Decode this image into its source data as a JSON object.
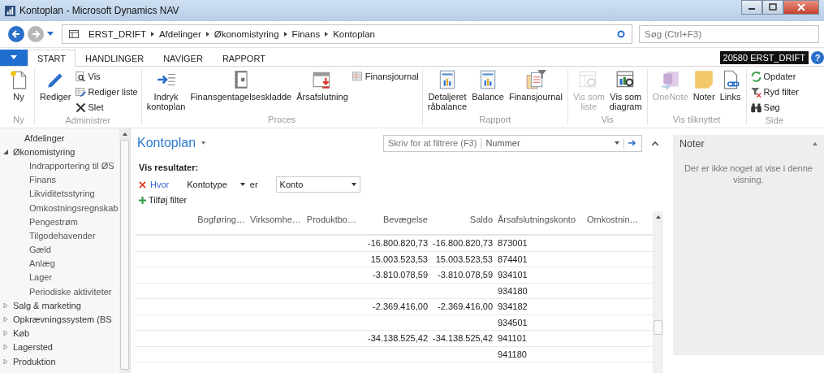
{
  "window": {
    "title": "Kontoplan - Microsoft Dynamics NAV"
  },
  "address_bar": {
    "breadcrumb": [
      "ERST_DRIFT",
      "Afdelinger",
      "Økonomistyring",
      "Finans",
      "Kontoplan"
    ],
    "search": {
      "placeholder": "Søg (Ctrl+F3)"
    }
  },
  "ribbon_tabs": [
    {
      "label": "START",
      "selected": true
    },
    {
      "label": "HANDLINGER",
      "selected": false
    },
    {
      "label": "NAVIGER",
      "selected": false
    },
    {
      "label": "RAPPORT",
      "selected": false
    }
  ],
  "company_badge": "20580 ERST_DRIFT",
  "help": "?",
  "ribbon_groups": [
    {
      "label": "Ny",
      "buttons": [
        {
          "label": "Ny",
          "kind": "large",
          "disabled": false
        }
      ]
    },
    {
      "label": "Administrer",
      "buttons": [
        {
          "label": "Rediger",
          "kind": "large",
          "disabled": false
        },
        {
          "label": "Vis",
          "kind": "small",
          "disabled": false
        },
        {
          "label": "Rediger liste",
          "kind": "small",
          "disabled": false
        },
        {
          "label": "Slet",
          "kind": "small",
          "disabled": false
        }
      ]
    },
    {
      "label": "Proces",
      "buttons": [
        {
          "label": "Indryk\nkontoplan",
          "kind": "large",
          "disabled": false
        },
        {
          "label": "Finansgentagelseskladde",
          "kind": "large",
          "disabled": false
        },
        {
          "label": "Årsafslutning",
          "kind": "large",
          "disabled": false
        },
        {
          "label": "Finansjournal",
          "kind": "small",
          "disabled": false
        }
      ]
    },
    {
      "label": "Rapport",
      "buttons": [
        {
          "label": "Detaljeret\nråbalance",
          "kind": "large",
          "disabled": false
        },
        {
          "label": "Balance",
          "kind": "large",
          "disabled": false
        },
        {
          "label": "Finansjournal",
          "kind": "large",
          "disabled": false
        }
      ]
    },
    {
      "label": "Vis",
      "buttons": [
        {
          "label": "Vis som\nliste",
          "kind": "large",
          "disabled": true
        },
        {
          "label": "Vis som\ndiagram",
          "kind": "large",
          "disabled": false
        }
      ]
    },
    {
      "label": "Vis tilknyttet",
      "buttons": [
        {
          "label": "OneNote",
          "kind": "large",
          "disabled": true
        },
        {
          "label": "Noter",
          "kind": "large",
          "disabled": false
        },
        {
          "label": "Links",
          "kind": "large",
          "disabled": false
        }
      ]
    },
    {
      "label": "Side",
      "buttons": [
        {
          "label": "Opdater",
          "kind": "small",
          "disabled": false
        },
        {
          "label": "Ryd filter",
          "kind": "small",
          "disabled": false
        },
        {
          "label": "Søg",
          "kind": "small",
          "disabled": false
        }
      ]
    }
  ],
  "navigation": [
    {
      "label": "Afdelinger"
    },
    {
      "label": "Økonomistyring",
      "expanded": true,
      "children": [
        {
          "label": "Indrapportering til ØS"
        },
        {
          "label": "Finans"
        },
        {
          "label": "Likviditetsstyring"
        },
        {
          "label": "Omkostningsregnskab"
        },
        {
          "label": "Pengestrøm"
        },
        {
          "label": "Tilgodehavender"
        },
        {
          "label": "Gæld"
        },
        {
          "label": "Anlæg"
        },
        {
          "label": "Lager"
        },
        {
          "label": "Periodiske aktiviteter"
        }
      ]
    },
    {
      "label": "Salg & marketing",
      "expanded": false
    },
    {
      "label": "Opkrævningssystem (BS",
      "expanded": false
    },
    {
      "label": "Køb",
      "expanded": false
    },
    {
      "label": "Lagersted",
      "expanded": false
    },
    {
      "label": "Produktion",
      "expanded": false
    }
  ],
  "page": {
    "title": "Kontoplan",
    "filter_search": {
      "placeholder": "Skriv for at filtrere (F3)",
      "field": "Nummer"
    },
    "filter": {
      "heading": "Vis resultater:",
      "where": "Hvor",
      "field": "Kontotype",
      "operator": "er",
      "value": "Konto",
      "add_filter": "Tilføj filter"
    }
  },
  "table": {
    "columns": [
      "Bogføring…",
      "Virksomhe…",
      "Produktbo…",
      "Bevægelse",
      "Saldo",
      "Årsafslutningskonto",
      "Omkostnin…"
    ],
    "rows": [
      {
        "cells": [
          null,
          null,
          null,
          "-16.800.820,73",
          "-16.800.820,73",
          "873001",
          null
        ]
      },
      {
        "cells": [
          null,
          null,
          null,
          "15.003.523,53",
          "15.003.523,53",
          "874401",
          null
        ]
      },
      {
        "cells": [
          null,
          null,
          null,
          "-3.810.078,59",
          "-3.810.078,59",
          "934101",
          null
        ]
      },
      {
        "cells": [
          null,
          null,
          null,
          null,
          null,
          "934180",
          null
        ]
      },
      {
        "cells": [
          null,
          null,
          null,
          "-2.369.416,00",
          "-2.369.416,00",
          "934182",
          null
        ]
      },
      {
        "cells": [
          null,
          null,
          null,
          null,
          null,
          "934501",
          null
        ]
      },
      {
        "cells": [
          null,
          null,
          null,
          "-34.138.525,42",
          "-34.138.525,42",
          "941101",
          null
        ]
      },
      {
        "cells": [
          null,
          null,
          null,
          null,
          null,
          "941180",
          null
        ]
      }
    ]
  },
  "factbox": {
    "title": "Noter",
    "message": "Der er ikke noget at vise i denne visning."
  }
}
